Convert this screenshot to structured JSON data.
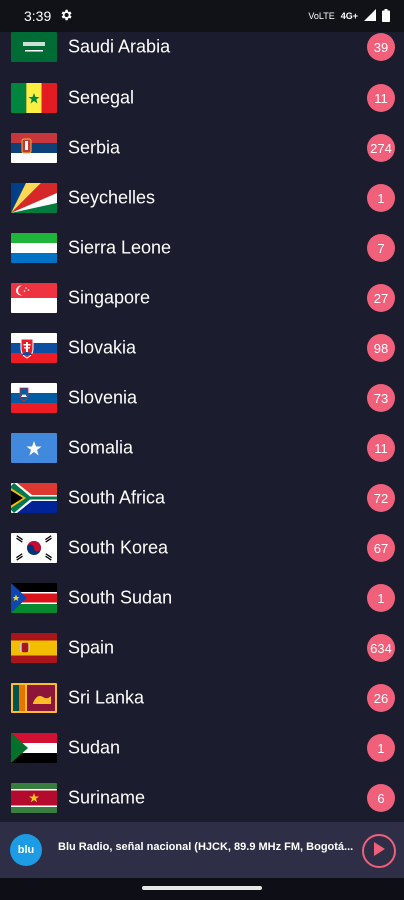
{
  "status_bar": {
    "time": "3:39",
    "settings_icon": "gear-icon",
    "volte_label": "VoLTE",
    "network_label": "4G+",
    "signal_icon": "signal-icon",
    "battery_icon": "battery-icon"
  },
  "countries": [
    {
      "name": "Saudi Arabia",
      "count": "39",
      "flag": "flag-saudi-arabia"
    },
    {
      "name": "Senegal",
      "count": "11",
      "flag": "flag-senegal"
    },
    {
      "name": "Serbia",
      "count": "274",
      "flag": "flag-serbia"
    },
    {
      "name": "Seychelles",
      "count": "1",
      "flag": "flag-seychelles"
    },
    {
      "name": "Sierra Leone",
      "count": "7",
      "flag": "flag-sierra-leone"
    },
    {
      "name": "Singapore",
      "count": "27",
      "flag": "flag-singapore"
    },
    {
      "name": "Slovakia",
      "count": "98",
      "flag": "flag-slovakia"
    },
    {
      "name": "Slovenia",
      "count": "73",
      "flag": "flag-slovenia"
    },
    {
      "name": "Somalia",
      "count": "11",
      "flag": "flag-somalia"
    },
    {
      "name": "South Africa",
      "count": "72",
      "flag": "flag-south-africa"
    },
    {
      "name": "South Korea",
      "count": "67",
      "flag": "flag-south-korea"
    },
    {
      "name": "South Sudan",
      "count": "1",
      "flag": "flag-south-sudan"
    },
    {
      "name": "Spain",
      "count": "634",
      "flag": "flag-spain"
    },
    {
      "name": "Sri Lanka",
      "count": "26",
      "flag": "flag-sri-lanka"
    },
    {
      "name": "Sudan",
      "count": "1",
      "flag": "flag-sudan"
    },
    {
      "name": "Suriname",
      "count": "6",
      "flag": "flag-suriname"
    }
  ],
  "player": {
    "logo_text": "blu",
    "station_title": "Blu Radio, señal nacional (HJCK, 89.9 MHz FM, Bogotá...",
    "play_icon": "play-icon"
  },
  "colors": {
    "background": "#1b1c2e",
    "badge": "#f0607a",
    "player_bar": "#2e2f46",
    "station_logo": "#1e9be5"
  }
}
